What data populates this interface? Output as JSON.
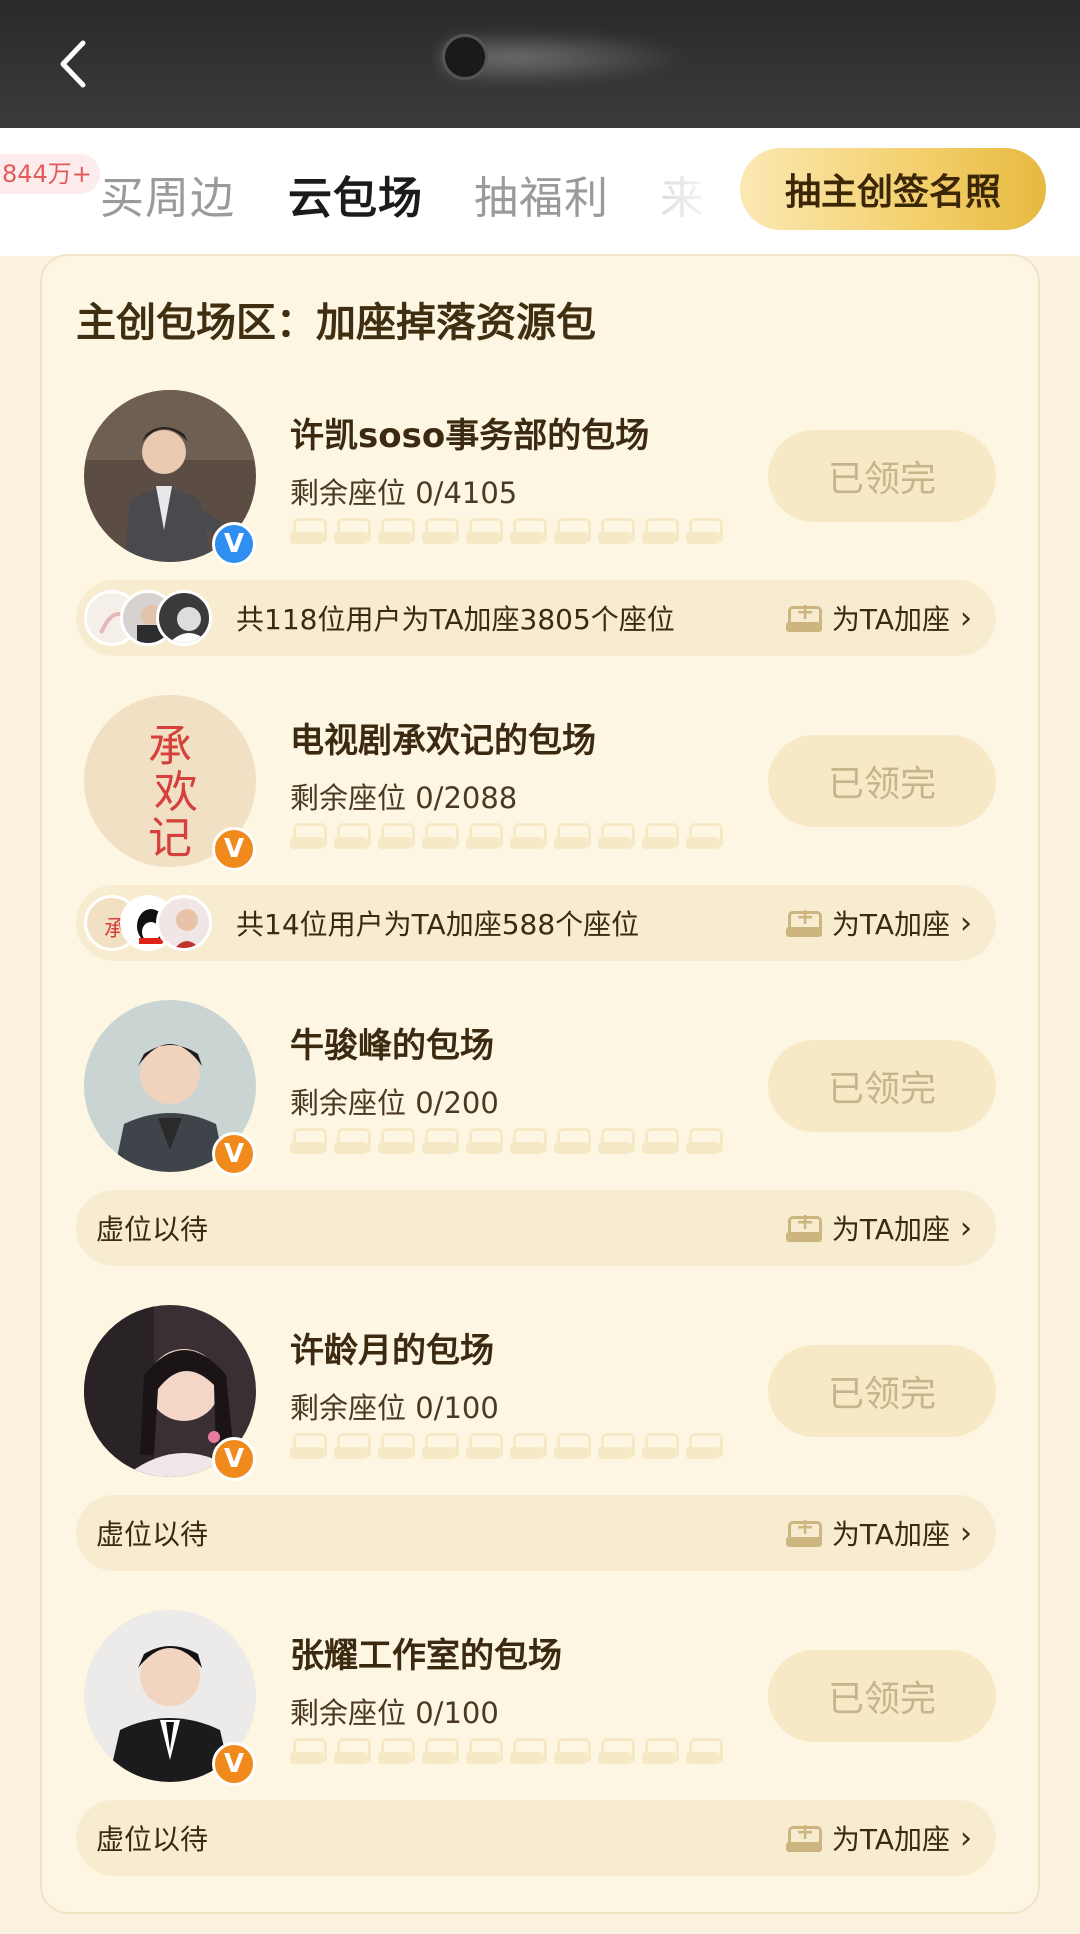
{
  "header": {
    "back_label": "<"
  },
  "tabs": {
    "badge": "844万+",
    "items": [
      {
        "label": "买周边"
      },
      {
        "label": "云包场"
      },
      {
        "label": "抽福利"
      },
      {
        "label": "来"
      }
    ],
    "cta_label": "抽主创签名照"
  },
  "section": {
    "title": "主创包场区：加座掉落资源包"
  },
  "entries": [
    {
      "name": "许凯soso事务部的包场",
      "seats": "剩余座位 0/4105",
      "status": "已领完",
      "badge_color": "blue",
      "info": "共118位用户为TA加座3805个座位",
      "add_label": "为TA加座"
    },
    {
      "name": "电视剧承欢记的包场",
      "seats": "剩余座位 0/2088",
      "status": "已领完",
      "badge_color": "orange",
      "info": "共14位用户为TA加座588个座位",
      "add_label": "为TA加座"
    },
    {
      "name": "牛骏峰的包场",
      "seats": "剩余座位 0/200",
      "status": "已领完",
      "badge_color": "orange",
      "info": "虚位以待",
      "add_label": "为TA加座"
    },
    {
      "name": "许龄月的包场",
      "seats": "剩余座位 0/100",
      "status": "已领完",
      "badge_color": "orange",
      "info": "虚位以待",
      "add_label": "为TA加座"
    },
    {
      "name": "张耀工作室的包场",
      "seats": "剩余座位 0/100",
      "status": "已领完",
      "badge_color": "orange",
      "info": "虚位以待",
      "add_label": "为TA加座"
    }
  ],
  "colors": {
    "accent_gold": "#f3cf6b",
    "card_bg": "#fdf6e3",
    "verified_blue": "#2f8ff0",
    "verified_orange": "#f08a1c"
  }
}
